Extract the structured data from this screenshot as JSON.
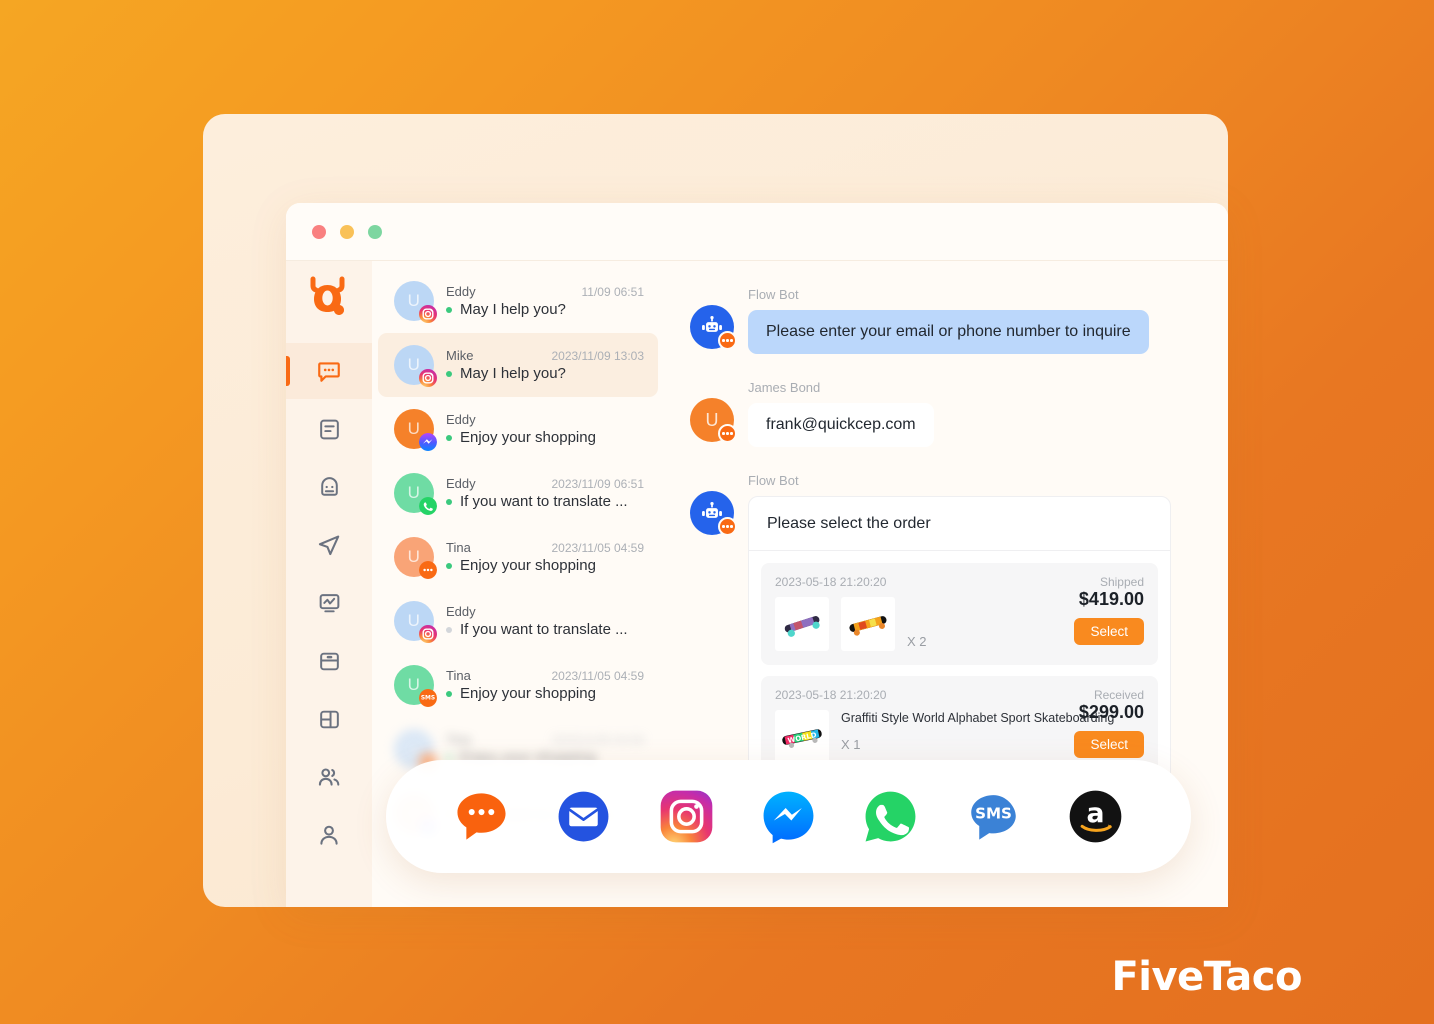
{
  "brand": {
    "logo_name": "quickcep-cow-logo",
    "watermark": "FiveTaco"
  },
  "window": {
    "traffic_lights": [
      "close",
      "minimize",
      "maximize"
    ]
  },
  "sidebar": {
    "items": [
      {
        "icon": "chat-bubble-icon",
        "label": "Chat",
        "active": true
      },
      {
        "icon": "document-icon",
        "label": "Documents",
        "active": false
      },
      {
        "icon": "bot-face-icon",
        "label": "Bot",
        "active": false
      },
      {
        "icon": "send-paper-plane-icon",
        "label": "Campaigns",
        "active": false
      },
      {
        "icon": "analytics-monitor-icon",
        "label": "Analytics",
        "active": false
      },
      {
        "icon": "archive-box-icon",
        "label": "Inbox",
        "active": false
      },
      {
        "icon": "layout-panel-icon",
        "label": "Layout",
        "active": false
      },
      {
        "icon": "people-group-icon",
        "label": "Contacts",
        "active": false
      },
      {
        "icon": "user-profile-icon",
        "label": "Profile",
        "active": false
      }
    ]
  },
  "conversations": [
    {
      "name": "Eddy",
      "time": "11/09 06:51",
      "message": "May I help you?",
      "avatar_initial": "U",
      "avatar_color": "#BCD7F5",
      "channel": "instagram",
      "unread": true,
      "selected": false
    },
    {
      "name": "Mike",
      "time": "2023/11/09 13:03",
      "message": "May I help you?",
      "avatar_initial": "U",
      "avatar_color": "#BCD7F5",
      "channel": "instagram",
      "unread": true,
      "selected": true
    },
    {
      "name": "Eddy",
      "time": "",
      "message": "Enjoy your shopping",
      "avatar_initial": "U",
      "avatar_color": "#F5812A",
      "channel": "messenger",
      "unread": true,
      "selected": false
    },
    {
      "name": "Eddy",
      "time": "2023/11/09 06:51",
      "message": "If you want to translate ...",
      "avatar_initial": "U",
      "avatar_color": "#6FDCA4",
      "channel": "whatsapp",
      "unread": true,
      "selected": false
    },
    {
      "name": "Tina",
      "time": "2023/11/05 04:59",
      "message": "Enjoy your shopping",
      "avatar_initial": "U",
      "avatar_color": "#F9A477",
      "channel": "livechat",
      "unread": true,
      "selected": false
    },
    {
      "name": "Eddy",
      "time": "",
      "message": "If you want to translate ...",
      "avatar_initial": "U",
      "avatar_color": "#BCD7F5",
      "channel": "instagram",
      "unread": false,
      "selected": false
    },
    {
      "name": "Tina",
      "time": "2023/11/05 04:59",
      "message": "Enjoy your shopping",
      "avatar_initial": "U",
      "avatar_color": "#6FDCA4",
      "channel": "sms",
      "unread": true,
      "selected": false
    },
    {
      "name": "Tina",
      "time": "2023/11/05 04:59",
      "message": "Enjoy your shopping",
      "avatar_initial": "U",
      "avatar_color": "#BCD7F5",
      "channel": "livechat",
      "unread": true,
      "selected": false
    },
    {
      "name": "",
      "time": "",
      "message": "If you want to translate ...",
      "avatar_initial": "U",
      "avatar_color": "#F9A477",
      "channel": "messenger",
      "unread": true,
      "selected": false
    }
  ],
  "chat": {
    "messages": [
      {
        "sender": "Flow Bot",
        "avatar": "bot",
        "text": "Please enter your email or phone number to inquire",
        "bubble": "bot"
      },
      {
        "sender": "James Bond",
        "avatar": "user",
        "text": "frank@quickcep.com",
        "bubble": "user"
      },
      {
        "sender": "Flow Bot",
        "avatar": "bot",
        "text": "Please select the order",
        "bubble": "order-card"
      }
    ],
    "order_card": {
      "title": "Please select the order",
      "orders": [
        {
          "date": "2023-05-18 21:20:20",
          "status": "Shipped",
          "product_name": "",
          "quantity": "X 2",
          "price": "$419.00",
          "select_label": "Select",
          "thumbs": [
            "skateboard-teal",
            "skateboard-orange"
          ]
        },
        {
          "date": "2023-05-18 21:20:20",
          "status": "Received",
          "product_name": "Graffiti Style World Alphabet Sport Skateboarding",
          "quantity": "X 1",
          "price": "$299.00",
          "select_label": "Select",
          "thumbs": [
            "skateboard-world"
          ]
        }
      ]
    }
  },
  "channels": [
    {
      "name": "livechat",
      "label": "Live Chat",
      "color": "#F9620E"
    },
    {
      "name": "email",
      "label": "Email",
      "color": "#2453E0"
    },
    {
      "name": "instagram",
      "label": "Instagram",
      "color": "#D62976"
    },
    {
      "name": "messenger",
      "label": "Messenger",
      "color": "#00B2FF"
    },
    {
      "name": "whatsapp",
      "label": "WhatsApp",
      "color": "#25D366"
    },
    {
      "name": "sms",
      "label": "SMS",
      "color": "#3B82D6"
    },
    {
      "name": "amazon",
      "label": "Amazon",
      "color": "#121212"
    }
  ],
  "colors": {
    "accent": "#F96A14",
    "background_gradient_start": "#F5A623",
    "background_gradient_end": "#E4701F",
    "card_background": "#FDEEDC",
    "window_background": "#FFFBF6",
    "bot_bubble": "#BBD7FB"
  }
}
